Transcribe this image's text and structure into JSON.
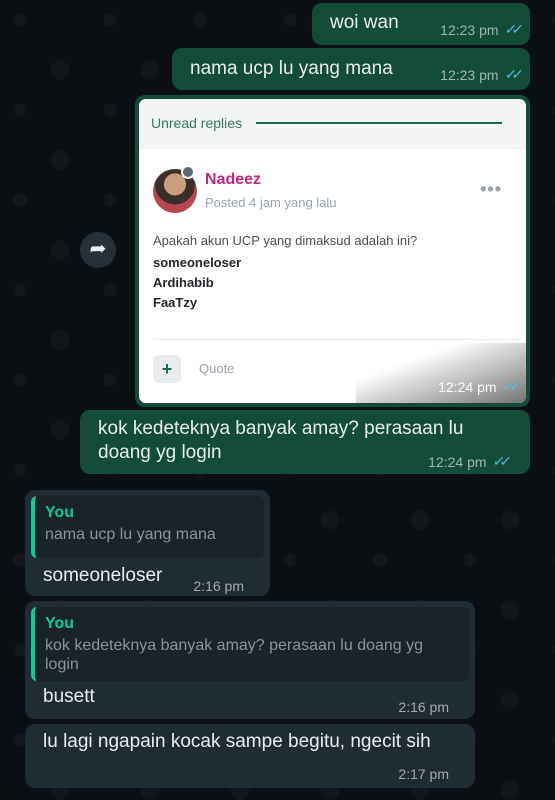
{
  "chat": [
    {
      "id": "m1",
      "text": "woi wan",
      "time": "12:23 pm"
    },
    {
      "id": "m2",
      "text": "nama ucp lu yang mana",
      "time": "12:23 pm"
    }
  ],
  "image_message": {
    "time": "12:24 pm",
    "card": {
      "header_label": "Unread replies",
      "username": "Nadeez",
      "posted": "Posted 4 jam yang lalu",
      "menu": "•••",
      "question": "Apakah akun UCP yang dimaksud adalah ini?",
      "accounts": [
        "someoneloser",
        "Ardihabib",
        "FaaTzy"
      ],
      "plus": "+",
      "quote_label": "Quote"
    }
  },
  "m3": {
    "text": "kok kedeteknya banyak amay? perasaan lu doang yg login",
    "time": "12:24 pm"
  },
  "incoming": [
    {
      "quote_author": "You",
      "quote_text": "nama ucp lu yang mana",
      "text": "someoneloser",
      "time": "2:16 pm"
    },
    {
      "quote_author": "You",
      "quote_text": "kok kedeteknya banyak amay? perasaan lu doang yg login",
      "text": "busett",
      "time": "2:16 pm"
    },
    {
      "text": "lu lagi ngapain kocak sampe begitu, ngecit sih",
      "time": "2:17 pm"
    }
  ],
  "icons": {
    "read_ticks": "double-check-icon",
    "forward": "forward-icon"
  },
  "colors": {
    "outgoing": "#144d37",
    "incoming": "#1f2c34",
    "accent": "#06cf9c",
    "ticks": "#53bdeb"
  }
}
